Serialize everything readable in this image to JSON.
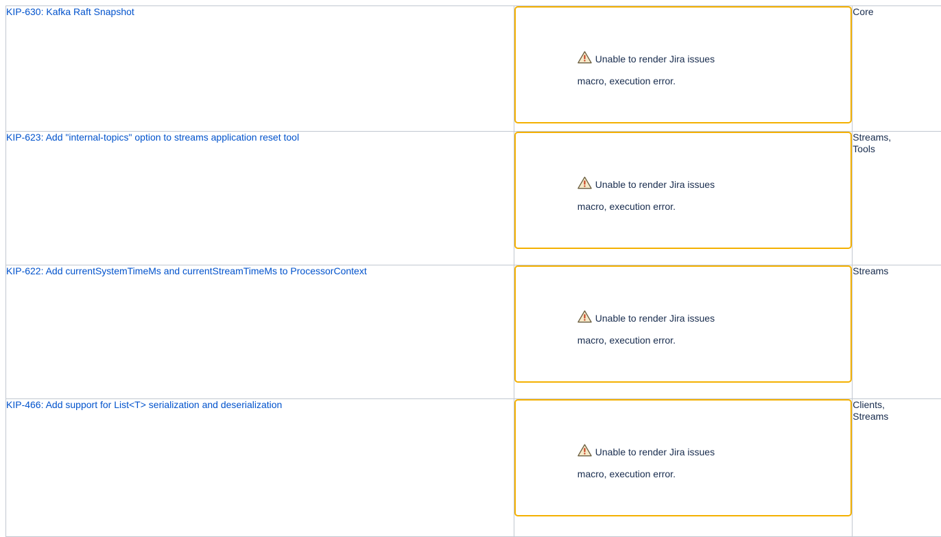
{
  "rows": [
    {
      "kip_link": "KIP-630: Kafka Raft Snapshot",
      "macro_warning": {
        "line1": "Unable to render Jira issues",
        "line2": "macro, execution error.",
        "icon": "warning-triangle-icon"
      },
      "component": "Core"
    },
    {
      "kip_link": "KIP-623: Add \"internal-topics\" option to streams application reset tool",
      "macro_warning": {
        "line1": "Unable to render Jira issues",
        "line2": "macro, execution error.",
        "icon": "warning-triangle-icon"
      },
      "component": "Streams, Tools"
    },
    {
      "kip_link": "KIP-622: Add currentSystemTimeMs and currentStreamTimeMs to ProcessorContext",
      "macro_warning": {
        "line1": "Unable to render Jira issues",
        "line2": "macro, execution error.",
        "icon": "warning-triangle-icon"
      },
      "component": "Streams"
    },
    {
      "kip_link": "KIP-466: Add support for List<T> serialization and deserialization",
      "macro_warning": {
        "line1": "Unable to render Jira issues",
        "line2": "macro, execution error.",
        "icon": "warning-triangle-icon"
      },
      "component": "Clients, Streams"
    }
  ],
  "colors": {
    "link": "#0052cc",
    "text": "#172b4d",
    "warning_border": "#f4b000",
    "table_border": "#c1c7d0"
  }
}
